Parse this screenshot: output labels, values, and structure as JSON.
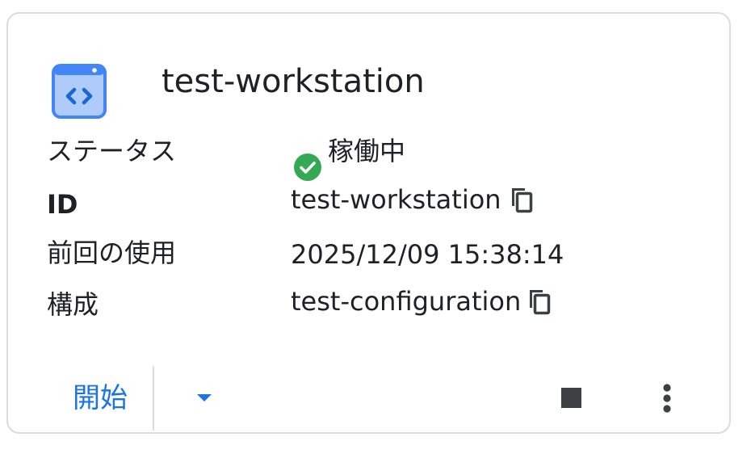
{
  "card": {
    "title": "test-workstation",
    "icon": "workstation-code-icon",
    "fields": {
      "status": {
        "label": "ステータス",
        "value": "稼働中",
        "icon": "check-circle-icon",
        "color": "#34a853"
      },
      "id": {
        "label": "ID",
        "value": "test-workstation",
        "icon": "copy-icon"
      },
      "last_used": {
        "label": "前回の使用",
        "value": "2025/12/09 15:38:14"
      },
      "config": {
        "label": "構成",
        "value": "test-configuration",
        "icon": "copy-icon"
      }
    },
    "actions": {
      "start_label": "開始",
      "dropdown_icon": "caret-down-icon",
      "stop_icon": "stop-icon",
      "more_icon": "more-vert-icon"
    }
  },
  "colors": {
    "accent": "#1a73e8",
    "icon_blue": "#4285f4",
    "status_green": "#34a853",
    "border": "#dadce0",
    "icon_gray": "#3c4043"
  }
}
